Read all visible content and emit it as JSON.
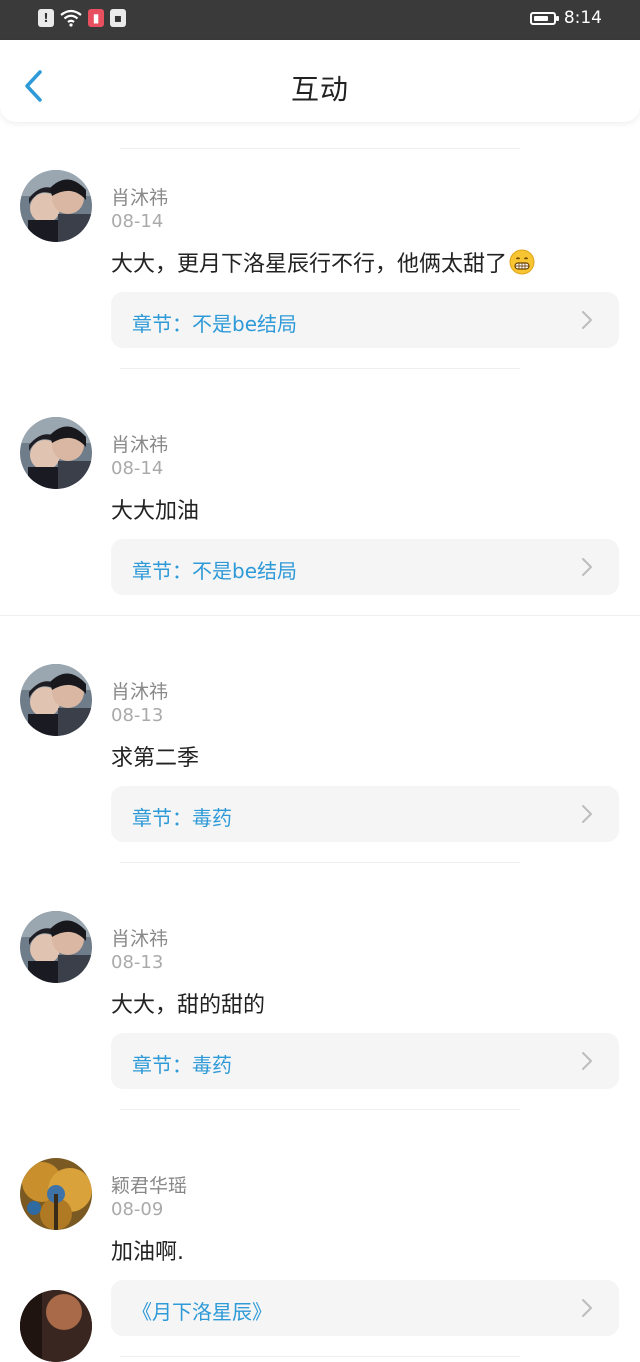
{
  "status_bar": {
    "time": "8:14",
    "battery_level": 0.8
  },
  "header": {
    "title": "互动"
  },
  "comments": [
    {
      "name": "肖沐祎",
      "date": "08-14",
      "comment": "大大，更月下洛星辰行不行，他俩太甜了",
      "emoji": "grin-emoji",
      "link": "章节：不是be结局"
    },
    {
      "name": "肖沐祎",
      "date": "08-14",
      "comment": "大大加油",
      "link": "章节：不是be结局"
    },
    {
      "name": "肖沐祎",
      "date": "08-13",
      "comment": "求第二季",
      "link": "章节：毒药"
    },
    {
      "name": "肖沐祎",
      "date": "08-13",
      "comment": "大大，甜的甜的",
      "link": "章节：毒药"
    },
    {
      "name": "颖君华瑶",
      "date": "08-09",
      "comment": "加油啊.",
      "link": "《月下洛星辰》"
    }
  ],
  "colors": {
    "accent": "#2f9ad8",
    "status_bar": "#3a3a3a",
    "card_bg": "#f5f5f5"
  }
}
